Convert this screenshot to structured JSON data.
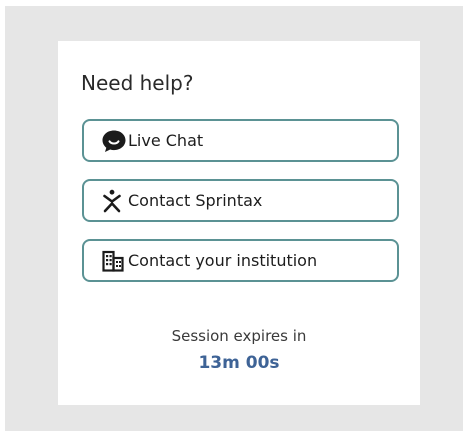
{
  "help": {
    "title": "Need help?",
    "buttons": [
      {
        "label": "Live Chat",
        "icon": "chat-bubble-icon"
      },
      {
        "label": "Contact Sprintax",
        "icon": "sprintax-logo-icon"
      },
      {
        "label": "Contact your institution",
        "icon": "building-icon"
      }
    ]
  },
  "session": {
    "label": "Session expires in",
    "timer": "13m 00s"
  },
  "colors": {
    "button_border": "#5b9294",
    "timer_text": "#3e6396",
    "backdrop": "#e6e6e6"
  }
}
